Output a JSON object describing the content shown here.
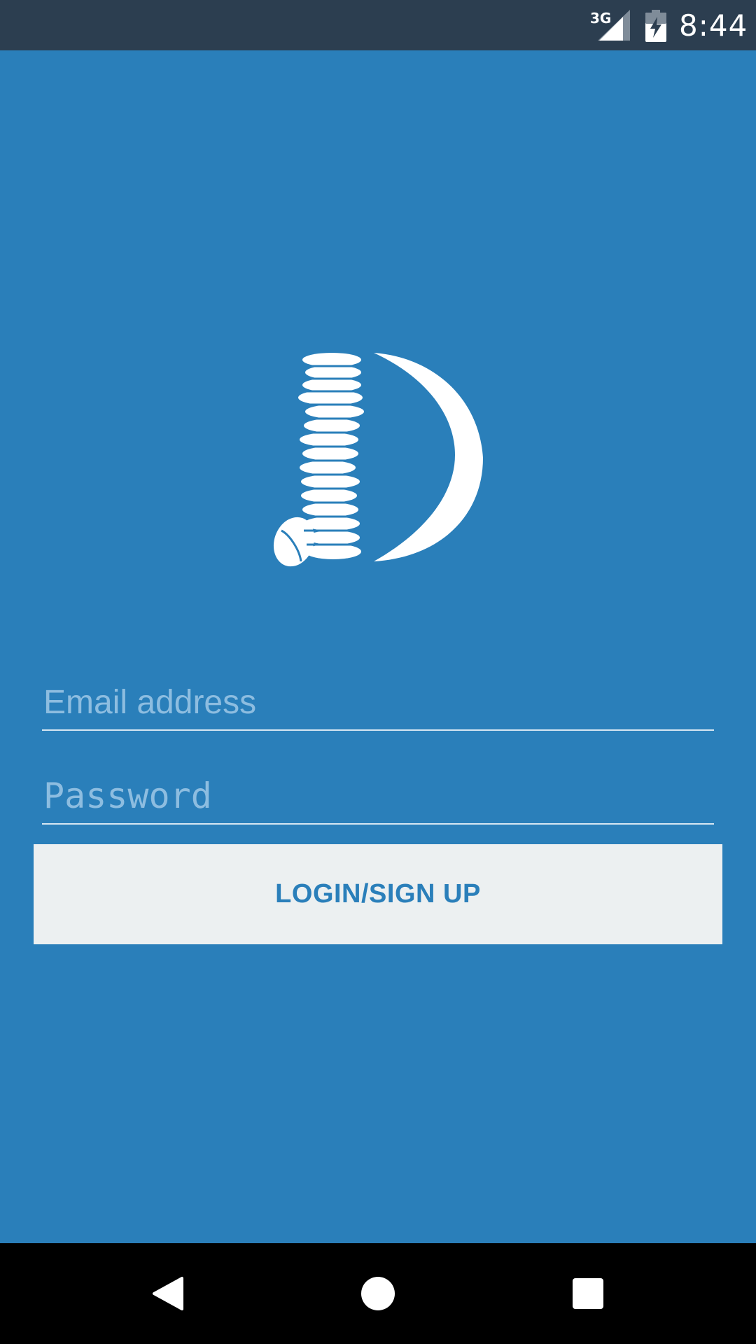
{
  "status_bar": {
    "network_type": "3G",
    "time": "8:44",
    "icons": [
      "signal-icon",
      "battery-charging-icon"
    ]
  },
  "logo": {
    "icon": "coin-stack-moon-logo"
  },
  "login_form": {
    "email_placeholder": "Email address",
    "email_value": "",
    "password_placeholder": "Password",
    "password_value": "",
    "submit_label": "LOGIN/SIGN UP"
  },
  "nav_bar": {
    "icons": [
      "back-icon",
      "home-icon",
      "recents-icon"
    ]
  },
  "colors": {
    "background": "#2a7fba",
    "status_bar": "#2c3e50",
    "button_bg": "#ecf0f1",
    "button_text": "#2a7fba",
    "placeholder": "#8dbde0",
    "nav_bar": "#000000"
  }
}
